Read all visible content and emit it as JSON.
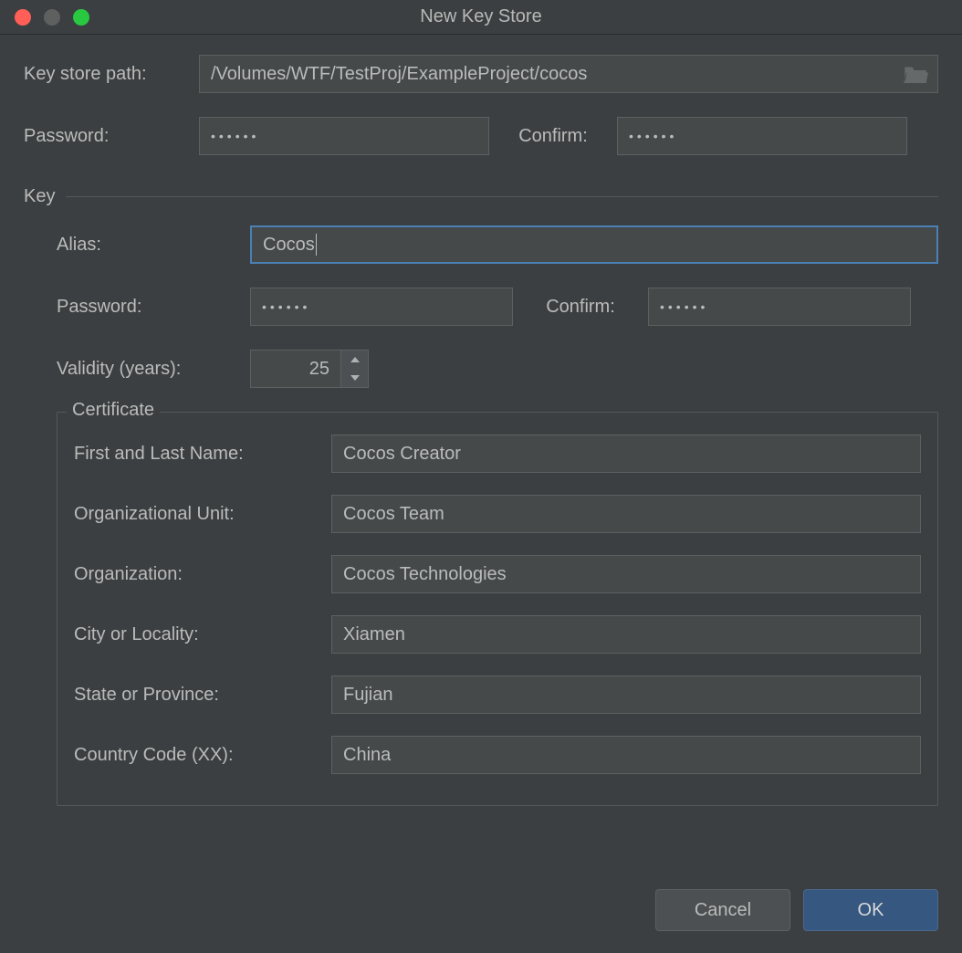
{
  "window": {
    "title": "New Key Store"
  },
  "keystore": {
    "path_label": "Key store path:",
    "path_value": "/Volumes/WTF/TestProj/ExampleProject/cocos",
    "password_label": "Password:",
    "password_value": "••••••",
    "confirm_label": "Confirm:",
    "confirm_value": "••••••"
  },
  "key": {
    "section_label": "Key",
    "alias_label": "Alias:",
    "alias_value": "Cocos",
    "password_label": "Password:",
    "password_value": "••••••",
    "confirm_label": "Confirm:",
    "confirm_value": "••••••",
    "validity_label": "Validity (years):",
    "validity_value": "25"
  },
  "certificate": {
    "section_label": "Certificate",
    "first_last_label": "First and Last Name:",
    "first_last_value": "Cocos Creator",
    "org_unit_label": "Organizational Unit:",
    "org_unit_value": "Cocos Team",
    "org_label": "Organization:",
    "org_value": "Cocos Technologies",
    "city_label": "City or Locality:",
    "city_value": "Xiamen",
    "state_label": "State or Province:",
    "state_value": "Fujian",
    "country_label": "Country Code (XX):",
    "country_value": "China"
  },
  "buttons": {
    "cancel": "Cancel",
    "ok": "OK"
  }
}
